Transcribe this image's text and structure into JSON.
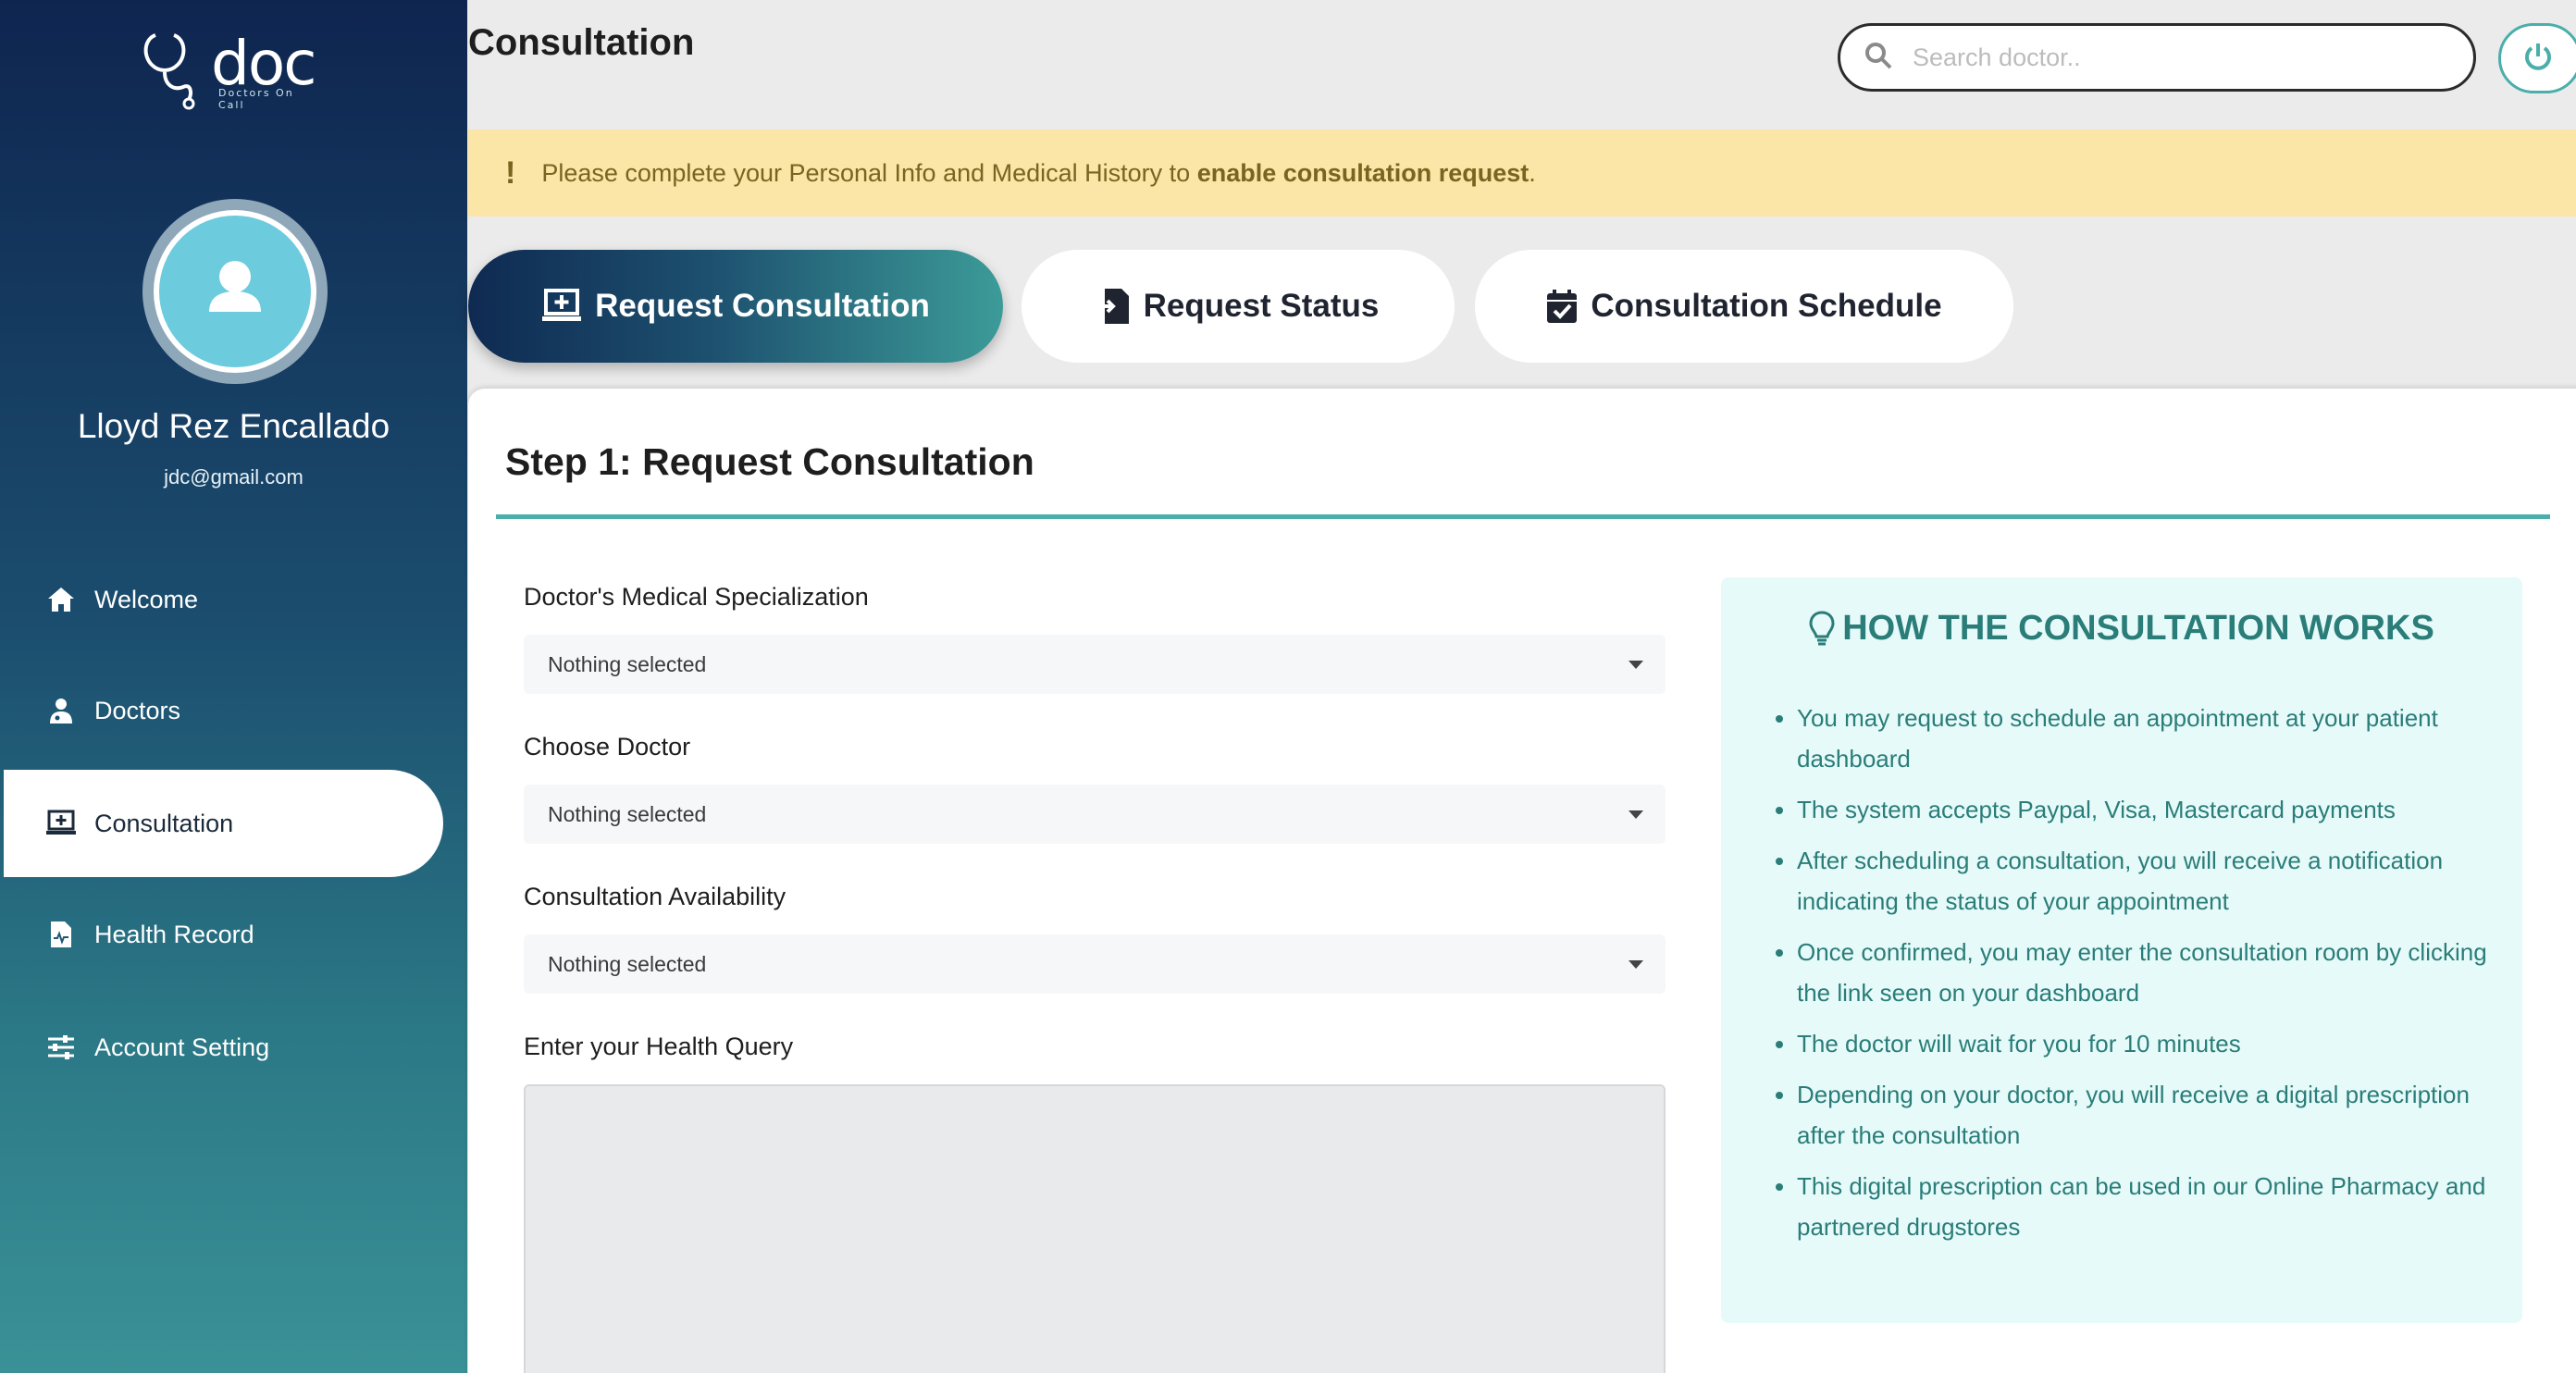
{
  "brand": {
    "logo_text": "doc",
    "logo_subtext": "Doctors On Call"
  },
  "user": {
    "name": "Lloyd Rez Encallado",
    "email": "jdc@gmail.com"
  },
  "nav": [
    {
      "label": "Welcome",
      "icon": "home-icon"
    },
    {
      "label": "Doctors",
      "icon": "doctor-icon"
    },
    {
      "label": "Consultation",
      "icon": "laptop-medical-icon",
      "active": true
    },
    {
      "label": "Health Record",
      "icon": "file-medical-icon"
    },
    {
      "label": "Account Setting",
      "icon": "sliders-icon"
    }
  ],
  "header": {
    "title": "Consultation",
    "search_placeholder": "Search doctor.."
  },
  "alert": {
    "icon": "!",
    "text_before": "Please complete your Personal Info and Medical History to ",
    "text_bold": "enable consultation request",
    "text_after": "."
  },
  "tabs": [
    {
      "label": "Request Consultation",
      "icon": "laptop-medical-icon",
      "active": true
    },
    {
      "label": "Request Status",
      "icon": "file-history-icon"
    },
    {
      "label": "Consultation Schedule",
      "icon": "calendar-check-icon"
    }
  ],
  "form": {
    "step_title": "Step 1: Request Consultation",
    "fields": [
      {
        "label": "Doctor's Medical Specialization",
        "value": "Nothing selected"
      },
      {
        "label": "Choose Doctor",
        "value": "Nothing selected"
      },
      {
        "label": "Consultation Availability",
        "value": "Nothing selected"
      }
    ],
    "query_label": "Enter your Health Query"
  },
  "info": {
    "title": "HOW THE CONSULTATION WORKS",
    "items": [
      "You may request to schedule an appointment at your patient dashboard",
      "The system accepts Paypal, Visa, Mastercard payments",
      "After scheduling a consultation, you will receive a notification indicating the status of your appointment",
      "Once confirmed, you may enter the consultation room by clicking the link seen on your dashboard",
      "The doctor will wait for you for 10 minutes",
      "Depending on your doctor, you will receive a digital prescription after the consultation",
      "This digital prescription can be used in our Online Pharmacy and partnered drugstores"
    ]
  },
  "colors": {
    "accent": "#4aaeab",
    "sidebar_top": "#0e2550",
    "sidebar_bottom": "#3a9196",
    "alert_bg": "#fbe5a7",
    "info_text": "#2a7d78"
  }
}
